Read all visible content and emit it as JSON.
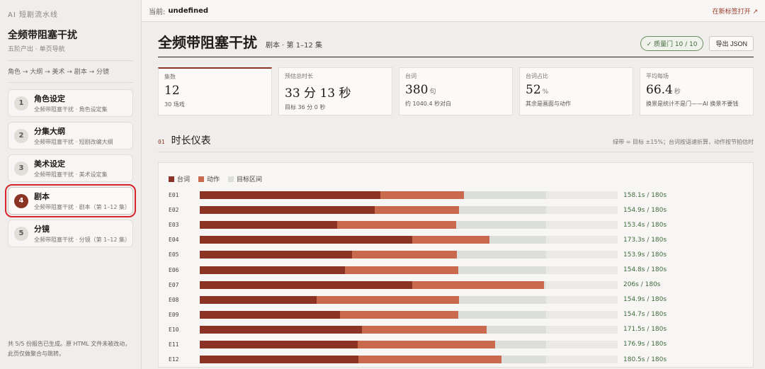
{
  "sidebar": {
    "brand": "AI 短剧流水线",
    "project_title": "全频带阻塞干扰",
    "project_sub": "五阶产出 · 单页导航",
    "pipeline": "角色 → 大纲 → 美术 → 剧本 → 分镜",
    "steps": [
      {
        "num": "1",
        "title": "角色设定",
        "sub": "全频带阻塞干扰 · 角色设定集"
      },
      {
        "num": "2",
        "title": "分集大纲",
        "sub": "全频带阻塞干扰 · 短剧改编大纲"
      },
      {
        "num": "3",
        "title": "美术设定",
        "sub": "全频带阻塞干扰 · 美术设定集"
      },
      {
        "num": "4",
        "title": "剧本",
        "sub": "全频带阻塞干扰 · 剧本（第 1–12 集）"
      },
      {
        "num": "5",
        "title": "分镜",
        "sub": "全频带阻塞干扰 · 分镜（第 1–12 集）"
      }
    ],
    "footer": "共 5/5 份报告已生成。原 HTML 文件未被改动，此页仅做聚合与跳转。"
  },
  "topbar": {
    "current_label": "当前:",
    "current_value": "undefined",
    "open_new": "在新标签打开 ↗"
  },
  "header": {
    "title": "全频带阻塞干扰",
    "subtitle": "剧本 · 第 1–12 集",
    "quality_badge": "✓ 质量门 10 / 10",
    "export_label": "导出 JSON"
  },
  "stats": [
    {
      "label": "集数",
      "value": "12",
      "unit": "",
      "note": "30 场戏"
    },
    {
      "label": "预估总时长",
      "value": "33 分 13 秒",
      "unit": "",
      "note": "目标 36 分 0 秒"
    },
    {
      "label": "台词",
      "value": "380",
      "unit": "句",
      "note": "约 1040.4 秒对白"
    },
    {
      "label": "台词占比",
      "value": "52",
      "unit": "%",
      "note": "其余是画面与动作"
    },
    {
      "label": "平均每场",
      "value": "66.4",
      "unit": "秒",
      "note": "换景是统计不是门——AI 换景不要钱"
    }
  ],
  "section": {
    "num": "01",
    "title": "时长仪表",
    "note": "绿带 = 目标 ±15%；台词按语速折算，动作按节拍估时"
  },
  "colors": {
    "dialogue": "#8b3324",
    "action": "#c9694d",
    "target": "#dcdedb",
    "ok_text": "#3f6a3a"
  },
  "chart_data": {
    "type": "bar",
    "stacked": true,
    "orientation": "horizontal",
    "legend": [
      "台词",
      "动作",
      "目标区间"
    ],
    "legend_placement": "top-left",
    "xlim": [
      0,
      250
    ],
    "target_range": [
      153,
      207
    ],
    "categories": [
      "E01",
      "E02",
      "E03",
      "E04",
      "E05",
      "E06",
      "E07",
      "E08",
      "E09",
      "E10",
      "E11",
      "E12"
    ],
    "series": [
      {
        "name": "台词",
        "values": [
          108.2,
          104.5,
          82.4,
          127.0,
          91.0,
          87.0,
          127.3,
          70.0,
          84.0,
          97.0,
          94.5,
          95.0
        ]
      },
      {
        "name": "动作",
        "values": [
          49.9,
          50.4,
          71.0,
          46.3,
          62.9,
          67.8,
          78.7,
          84.9,
          70.7,
          74.5,
          82.4,
          85.5
        ]
      }
    ],
    "labels": [
      "158.1s / 180s",
      "154.9s / 180s",
      "153.4s / 180s",
      "173.3s / 180s",
      "153.9s / 180s",
      "154.8s / 180s",
      "206s / 180s",
      "154.9s / 180s",
      "154.7s / 180s",
      "171.5s / 180s",
      "176.9s / 180s",
      "180.5s / 180s"
    ]
  }
}
